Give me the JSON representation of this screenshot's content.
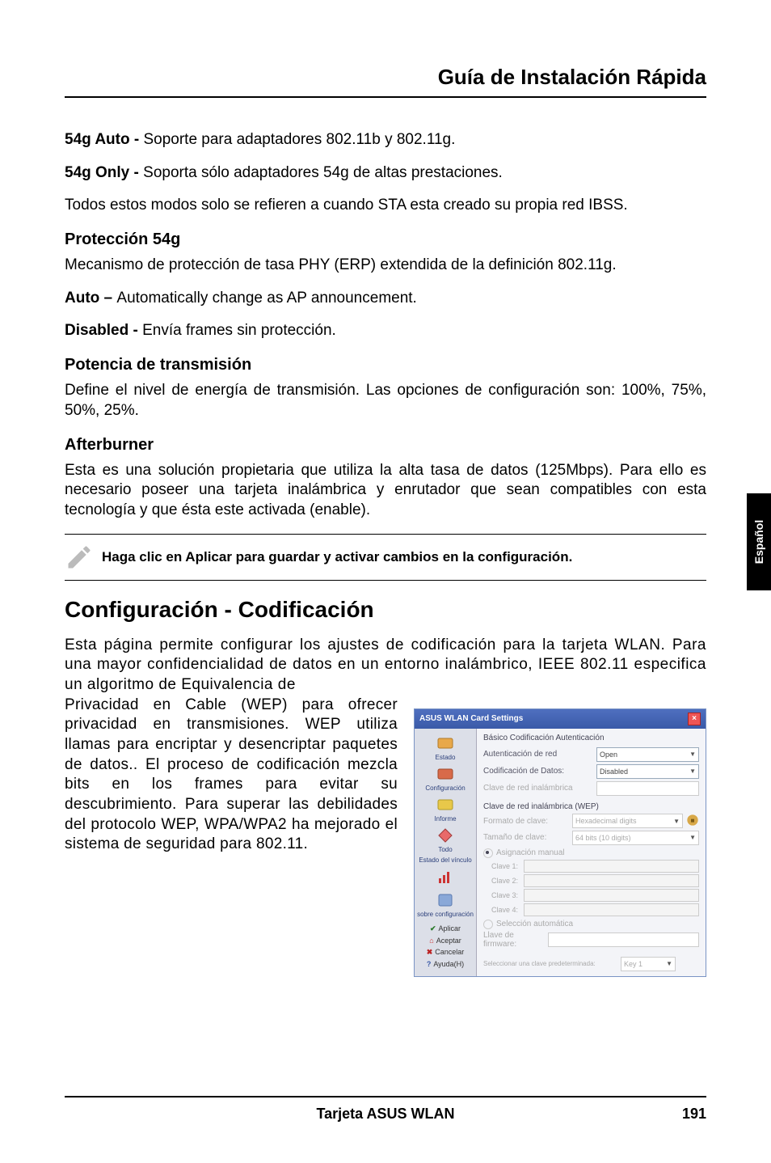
{
  "header": {
    "title": "Guía de Instalación Rápida"
  },
  "side_tab": "Español",
  "p1": {
    "bold": "54g Auto - ",
    "text": "Soporte para adaptadores 802.11b y 802.11g."
  },
  "p2": {
    "bold": "54g Only - ",
    "text": "Soporta sólo adaptadores 54g de altas prestaciones."
  },
  "p3": "Todos estos modos solo se refieren a cuando STA esta creado su propia red IBSS.",
  "h1": "Protección 54g",
  "p4": "Mecanismo de protección de tasa PHY (ERP) extendida de la definición 802.11g.",
  "p5": {
    "bold": "Auto – ",
    "text": "Automatically change as AP announcement."
  },
  "p6": {
    "bold": "Disabled - ",
    "text": "Envía frames sin protección."
  },
  "h2": "Potencia de transmisión",
  "p7": "Define el nivel de energía de transmisión. Las opciones de configuración son: 100%, 75%, 50%, 25%.",
  "h3": "Afterburner",
  "p8": "Esta es una solución propietaria que utiliza la alta tasa de datos (125Mbps). Para ello es necesario poseer una tarjeta inalámbrica y enrutador que sean compatibles con esta tecnología y que ésta este activada (enable).",
  "note": "Haga clic en Aplicar para guardar y activar cambios en la configuración.",
  "section": "Configuración - Codificación",
  "p9": "Esta página permite configurar los ajustes de codificación para la tarjeta WLAN. Para una mayor confidencialidad de datos en un entorno inalámbrico, IEEE 802.11 especifica un algoritmo de Equivalencia de",
  "p10": "Privacidad en Cable (WEP) para ofrecer privacidad en transmisiones. WEP utiliza llamas para encriptar y desencriptar paquetes de datos.. El proceso de codificación mezcla bits en los frames para evitar su descubrimiento. Para superar las debilidades del protocolo WEP, WPA/WPA2 ha mejorado el sistema de seguridad para 802.11.",
  "footer": {
    "center": "Tarjeta ASUS WLAN",
    "right": "191"
  },
  "screenshot": {
    "title": "ASUS WLAN Card Settings",
    "tabs": "Básico   Codificación   Autenticación",
    "sidebar": {
      "items": [
        {
          "label": "Estado"
        },
        {
          "label": "Configuración"
        },
        {
          "label": "Informe"
        },
        {
          "label": "Todo"
        },
        {
          "label": "Estado del vínculo"
        },
        {
          "label": ""
        },
        {
          "label": "sobre configuración"
        }
      ],
      "actions": [
        {
          "icon": "check",
          "label": "Aplicar"
        },
        {
          "icon": "home",
          "label": "Aceptar"
        },
        {
          "icon": "cross",
          "label": "Cancelar"
        },
        {
          "icon": "question",
          "label": "Ayuda(H)"
        }
      ]
    },
    "fields": {
      "auth_label": "Autenticación de red",
      "auth_value": "Open",
      "enc_label": "Codificación de Datos:",
      "enc_value": "Disabled",
      "netkey_label": "Clave de red inalámbrica",
      "group_title": "Clave de red inalámbrica (WEP)",
      "fmt_label": "Formato de clave:",
      "fmt_value": "Hexadecimal digits",
      "len_label": "Tamaño de clave:",
      "len_value": "64 bits (10 digits)",
      "manual_radio": "Asignación manual",
      "key1": "Clave 1:",
      "key2": "Clave 2:",
      "key3": "Clave 3:",
      "key4": "Clave 4:",
      "auto_radio": "Selección automática",
      "default_label": "Llave de firmware:",
      "btm_label": "Seleccionar una clave predeterminada:",
      "btm_value": "Key 1"
    }
  }
}
